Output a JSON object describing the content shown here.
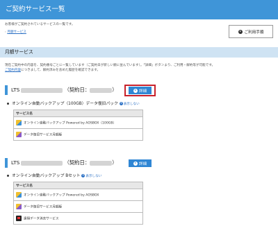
{
  "page": {
    "title": "ご契約サービス一覧",
    "intro": "お客様がご契約されているサービスの一覧です。",
    "nav_link": "月額サービス",
    "guide_button": "ご利用手順"
  },
  "section": {
    "title": "月額サービス",
    "desc_line1": "現在ご契約中の内容を、契約番号ごとに一覧しています（ご契約日が新しい順に並んでいます）。「詳細」ボタンより、ご利用・解約等が可能です。",
    "desc_link": "ご契約内容",
    "desc_line2": "につきまして、解約済みを含めた履歴を確認できます。"
  },
  "contracts": [
    {
      "prefix": "LTS",
      "date_label": "（契約日：",
      "date_close": "）",
      "detail_button": "詳細",
      "plan_name": "オンライン自動バックアップ（100GB）データ復旧パック",
      "view_link": "表示しない",
      "table_header": "サービス名",
      "services": [
        {
          "icon": "backup-icon",
          "name": "オンライン自動バックアップ Powered by AOSBOX（100GB）"
        },
        {
          "icon": "data-recovery-icon",
          "name": "データ復旧サービス月額版"
        }
      ]
    },
    {
      "prefix": "LTS",
      "date_label": "（契約日：",
      "date_close": "）",
      "detail_button": "詳細",
      "plan_name": "オンライン自動バックアップ Bセット",
      "view_link": "表示しない",
      "table_header": "サービス名",
      "services": [
        {
          "icon": "backup-icon",
          "name": "オンライン自動バックアップ Powered by AOSBOX"
        },
        {
          "icon": "data-recovery-icon",
          "name": "データ復旧サービス月額版"
        },
        {
          "icon": "data-erase-icon",
          "name": "遠隔データ消去サービス"
        }
      ]
    }
  ],
  "colors": {
    "header_blue": "#3f95d8",
    "section_band": "#cfe3f3",
    "button_blue": "#2f86d4",
    "highlight_red": "#c8202a"
  }
}
